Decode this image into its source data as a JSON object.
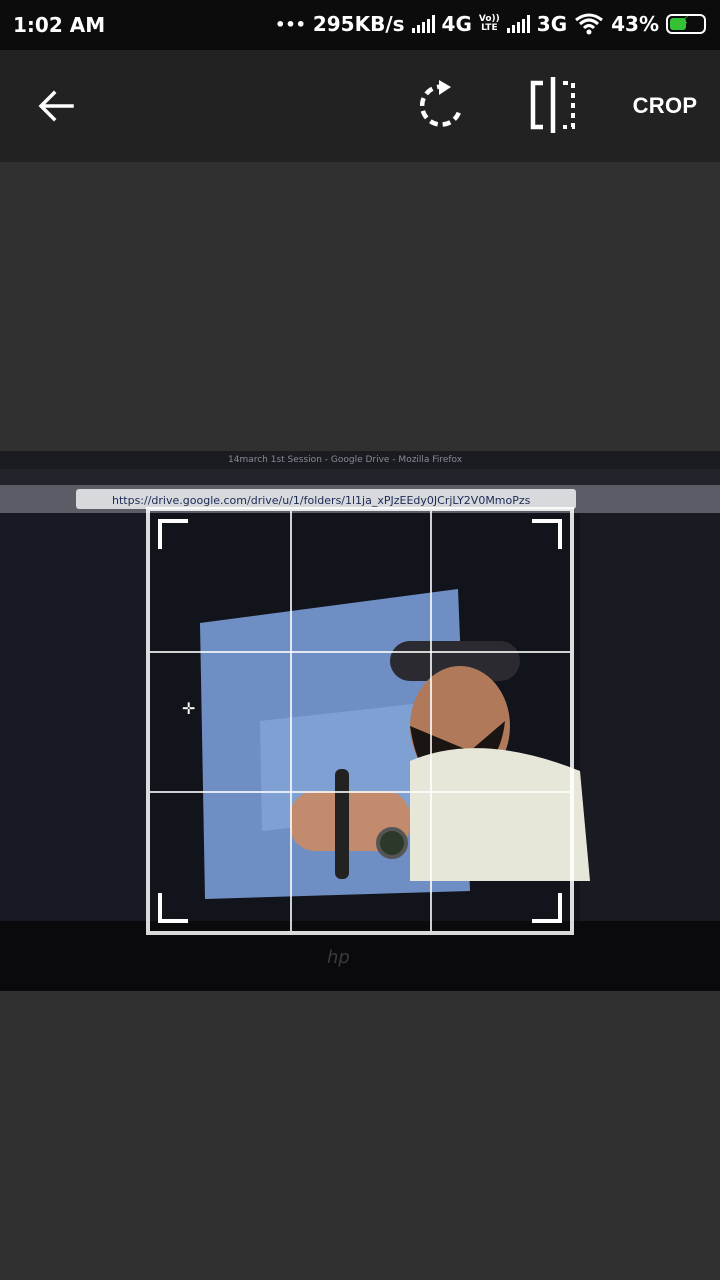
{
  "status_bar": {
    "time": "1:02 AM",
    "dots": "•••",
    "speed": "295KB/s",
    "network1": "4G",
    "volte_top": "Vo))",
    "volte_bottom": "LTE",
    "network2": "3G",
    "battery": "43%",
    "icons": [
      "signal-icon",
      "volte-icon",
      "wifi-icon",
      "battery-charging-icon"
    ]
  },
  "toolbar": {
    "crop_label": "CROP",
    "icons": [
      "back-arrow-icon",
      "rotate-icon",
      "flip-icon"
    ]
  },
  "photo": {
    "browser_title": "14march 1st Session - Google Drive - Mozilla Firefox",
    "url": "https://drive.google.com/drive/u/1/folders/1l1ja_xPJzEEdy0JCrjLY2V0MmoPzs",
    "logo_text": "hp"
  },
  "crop_overlay": {
    "icons": [
      "move-icon"
    ]
  },
  "colors": {
    "status_bar_bg": "#0c0c0c",
    "toolbar_bg": "#222222",
    "canvas_bg": "#303030",
    "battery_accent": "#34c234"
  }
}
